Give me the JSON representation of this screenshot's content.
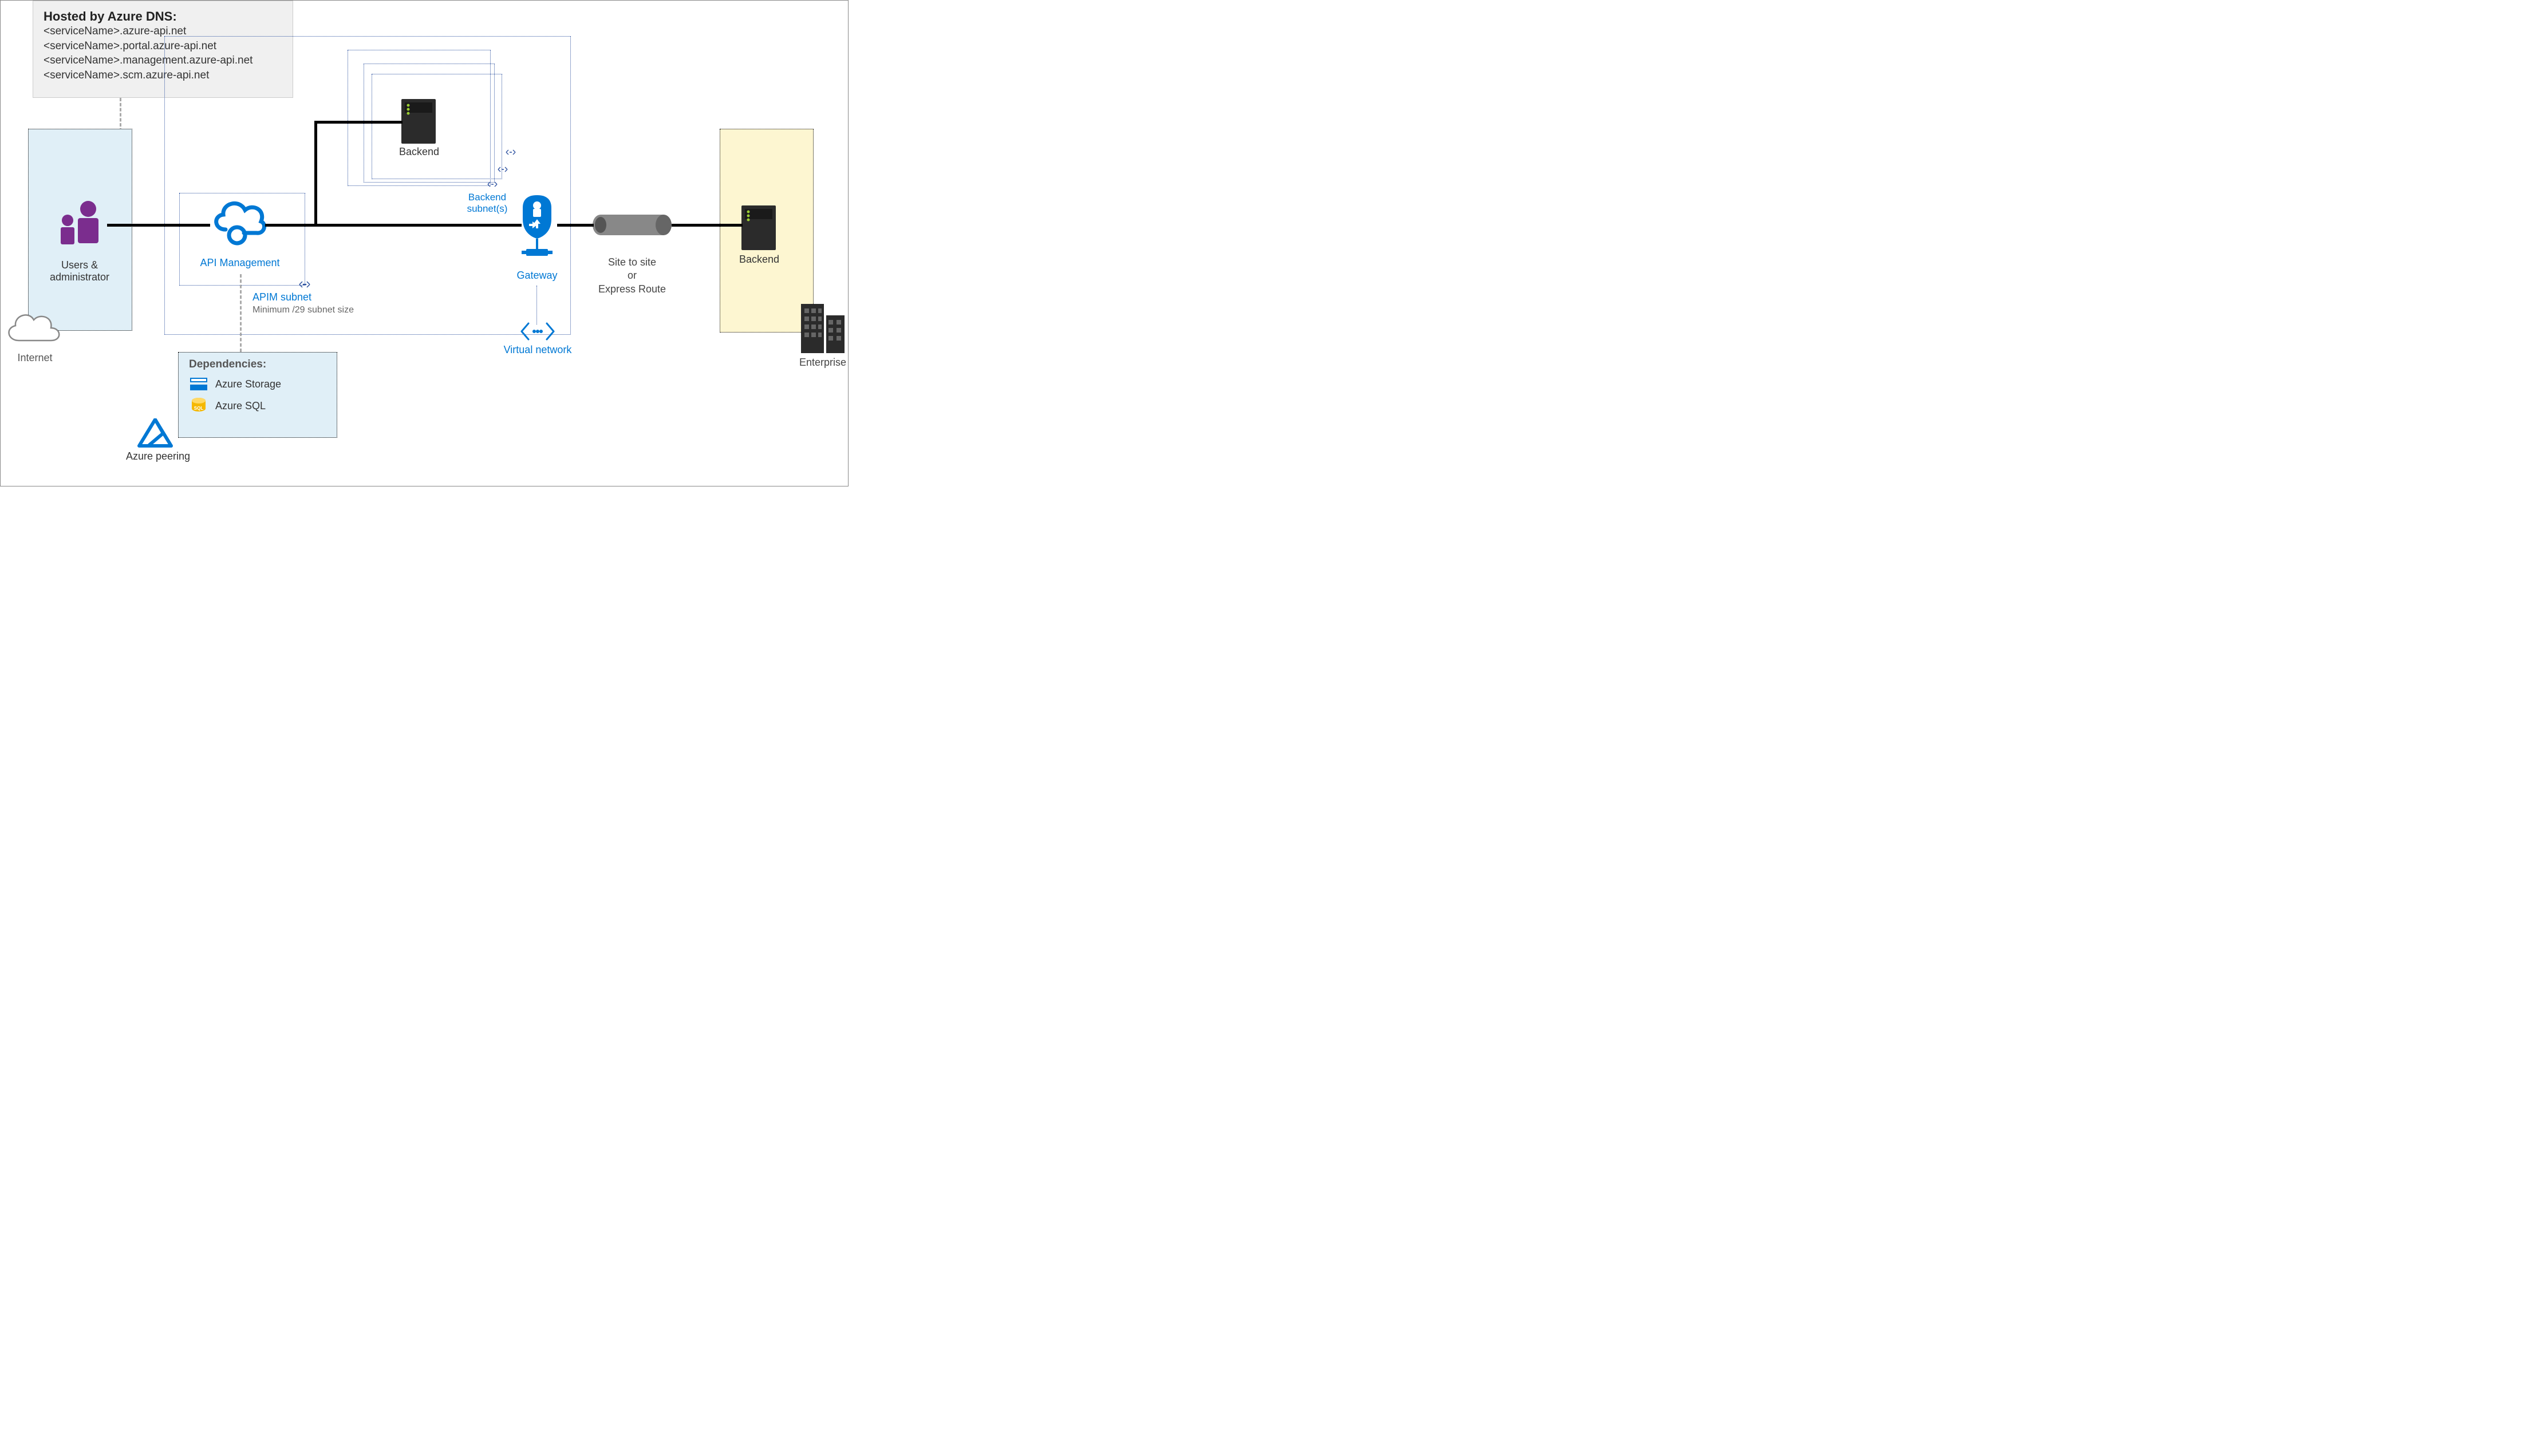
{
  "dns": {
    "title": "Hosted by Azure DNS:",
    "lines": [
      "<serviceName>.azure-api.net",
      "<serviceName>.portal.azure-api.net",
      "<serviceName>.management.azure-api.net",
      "<serviceName>.scm.azure-api.net"
    ]
  },
  "internet": {
    "label": "Internet"
  },
  "users": {
    "label": "Users & administrator"
  },
  "apim": {
    "label": "API Management",
    "subnet_label": "APIM subnet",
    "subnet_note": "Minimum /29 subnet size"
  },
  "backend_top": {
    "label": "Backend"
  },
  "backend_subnet_label": "Backend subnet(s)",
  "gateway": {
    "label": "Gateway"
  },
  "vnet": {
    "label": "Virtual network"
  },
  "pipe": {
    "line1": "Site to site",
    "line2": "or",
    "line3": "Express Route"
  },
  "enterprise": {
    "backend_label": "Backend",
    "label": "Enterprise"
  },
  "dependencies": {
    "title": "Dependencies:",
    "items": [
      "Azure Storage",
      "Azure SQL"
    ]
  },
  "azure_peering": {
    "label": "Azure peering"
  }
}
